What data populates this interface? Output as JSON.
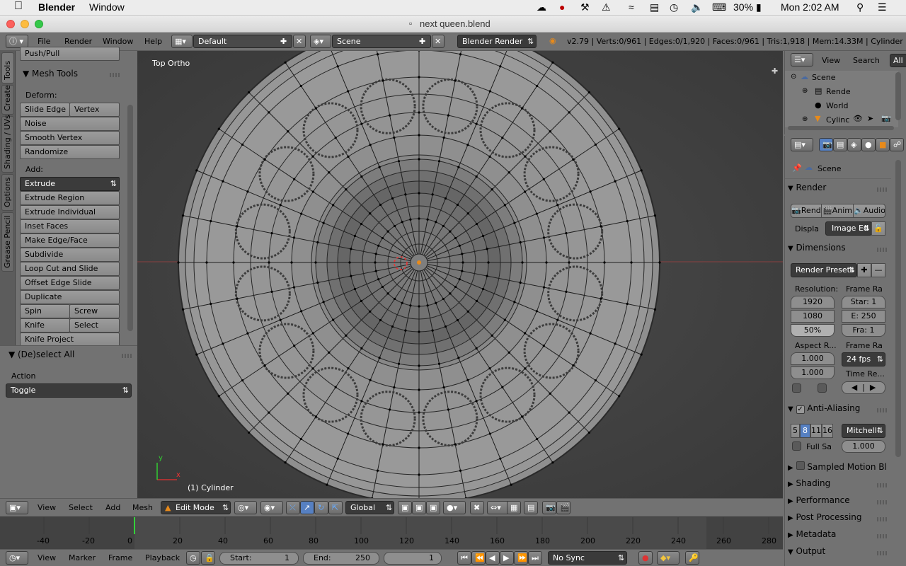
{
  "mac_menubar": {
    "apple": "",
    "app_name": "Blender",
    "menu": "Window",
    "battery": "30%",
    "clock": "Mon 2:02 AM"
  },
  "titlebar": {
    "title": "next queen.blend"
  },
  "info_header": {
    "menus": [
      "File",
      "Render",
      "Window",
      "Help"
    ],
    "layout": "Default",
    "scene": "Scene",
    "engine": "Blender Render",
    "stats": "v2.79 | Verts:0/961 | Edges:0/1,920 | Faces:0/961 | Tris:1,918 | Mem:14.33M | Cylinder"
  },
  "tool_tabs": [
    "Tools",
    "Create",
    "Shading / UVs",
    "Options",
    "Grease Pencil"
  ],
  "tool_shelf": {
    "top_cut": "Push/Pull",
    "panel_title": "Mesh Tools",
    "deform_label": "Deform:",
    "slide_edge": "Slide Edge",
    "vertex": "Vertex",
    "noise": "Noise",
    "smooth_vertex": "Smooth Vertex",
    "randomize": "Randomize",
    "add_label": "Add:",
    "extrude": "Extrude",
    "extrude_region": "Extrude Region",
    "extrude_individual": "Extrude Individual",
    "inset_faces": "Inset Faces",
    "make_edge_face": "Make Edge/Face",
    "subdivide": "Subdivide",
    "loop_cut": "Loop Cut and Slide",
    "offset_edge": "Offset Edge Slide",
    "duplicate": "Duplicate",
    "spin": "Spin",
    "screw": "Screw",
    "knife": "Knife",
    "select": "Select",
    "knife_project": "Knife Project"
  },
  "operator_panel": {
    "title": "(De)select All",
    "action_label": "Action",
    "action_value": "Toggle"
  },
  "viewport": {
    "view_label": "Top Ortho",
    "object_label": "(1) Cylinder",
    "axis_x": "x",
    "axis_y": "y"
  },
  "view3d_header": {
    "menus": [
      "View",
      "Select",
      "Add",
      "Mesh"
    ],
    "mode": "Edit Mode",
    "orientation": "Global"
  },
  "timeline": {
    "ticks": [
      "-40",
      "-20",
      "0",
      "20",
      "40",
      "60",
      "80",
      "100",
      "120",
      "140",
      "160",
      "180",
      "200",
      "220",
      "240",
      "260",
      "280"
    ]
  },
  "timeline_header": {
    "menus": [
      "View",
      "Marker",
      "Frame",
      "Playback"
    ],
    "start_label": "Start:",
    "start_value": "1",
    "end_label": "End:",
    "end_value": "250",
    "current_frame": "1",
    "sync": "No Sync"
  },
  "outliner": {
    "menus": [
      "View",
      "Search",
      "All"
    ],
    "items": [
      "Scene",
      "Rende",
      "World",
      "Cylinc"
    ]
  },
  "properties": {
    "context": "Scene",
    "render_panel": "Render",
    "render_btn": "Rend",
    "anim_btn": "Anim",
    "audio_btn": "Audio",
    "display_label": "Displa",
    "display_value": "Image Ed",
    "dimensions_panel": "Dimensions",
    "render_presets": "Render Presets",
    "resolution_label": "Resolution:",
    "res_x": "1920",
    "res_y": "1080",
    "res_pct": "50%",
    "frame_range_label": "Frame Ra",
    "frame_start": "Star: 1",
    "frame_end": "E: 250",
    "frame_step": "Fra: 1",
    "aspect_label": "Aspect R...",
    "aspect_x": "1.000",
    "aspect_y": "1.000",
    "frame_rate_label": "Frame Ra",
    "fps": "24 fps",
    "time_remap_label": "Time Re...",
    "aa_panel": "Anti-Aliasing",
    "aa_samples": [
      "5",
      "8",
      "11",
      "16"
    ],
    "aa_filter": "Mitchell-",
    "full_sample": "Full Sa",
    "aa_size": "1.000",
    "sampled_motion": "Sampled Motion Bl",
    "shading": "Shading",
    "performance": "Performance",
    "post_processing": "Post Processing",
    "metadata": "Metadata",
    "output": "Output"
  }
}
